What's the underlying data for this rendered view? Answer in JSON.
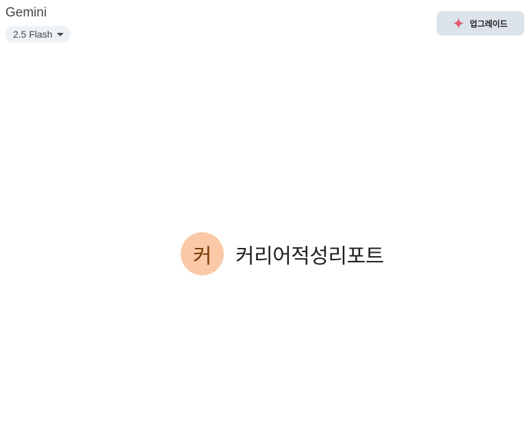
{
  "header": {
    "app_title": "Gemini",
    "model_selector": {
      "selected": "2.5 Flash",
      "icon": "chevron-down-icon"
    },
    "upgrade_button": {
      "label": "업그레이드",
      "icon": "sparkle-icon",
      "icon_color": "#e06070"
    }
  },
  "gem": {
    "avatar_letter": "커",
    "name": "커리어적성리포트",
    "avatar_color": "#fbc9a8"
  }
}
